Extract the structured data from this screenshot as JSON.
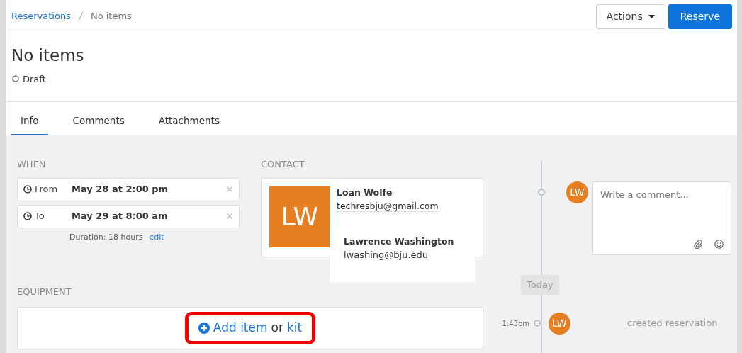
{
  "breadcrumb": [
    {
      "label": "Reservations",
      "kind": "link"
    },
    {
      "label": "No items",
      "kind": "current"
    }
  ],
  "actions": {
    "menu": "Actions",
    "primary": "Reserve"
  },
  "title": "No items",
  "status": {
    "label": "Draft"
  },
  "tabs": [
    {
      "label": "Info",
      "selected": true
    },
    {
      "label": "Comments",
      "selected": false
    },
    {
      "label": "Attachments",
      "selected": false
    }
  ],
  "when": {
    "heading": "WHEN",
    "rows": [
      {
        "label": "From",
        "value": "May 28 at 2:00 pm"
      },
      {
        "label": "To",
        "value": "May 29 at 8:00 am"
      }
    ],
    "duration": "Duration: 18 hours",
    "edit": "edit"
  },
  "contact": {
    "heading": "CONTACT",
    "initials": "LW",
    "name": "Loan Wolfe",
    "email": "techresbju@gmail.com"
  },
  "overlay": {
    "name": "Lawrence Washington",
    "email": "lwashing@bju.edu"
  },
  "equipment": {
    "heading": "EQUIPMENT",
    "add": "Add item",
    "or": "or",
    "kit": "kit"
  },
  "timeline": {
    "comment": {
      "initials": "LW",
      "placeholder": "Write a comment..."
    },
    "divider": "Today",
    "events": [
      {
        "time": "1:43pm",
        "initials": "LW",
        "text": "created reservation"
      }
    ]
  }
}
